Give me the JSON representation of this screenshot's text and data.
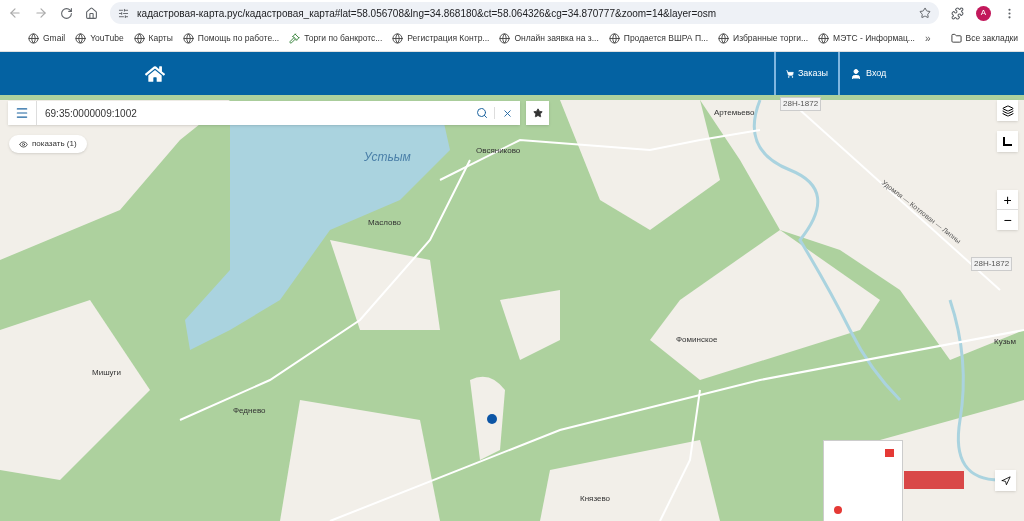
{
  "browser": {
    "url": "кадастровая-карта.рус/кадастровая_карта#lat=58.056708&lng=34.868180&ct=58.064326&cg=34.870777&zoom=14&layer=osm",
    "profile": "A",
    "bookmarks": [
      {
        "label": "Gmail",
        "kind": "globe"
      },
      {
        "label": "YouTube",
        "kind": "globe"
      },
      {
        "label": "Карты",
        "kind": "globe"
      },
      {
        "label": "Помощь по работе...",
        "kind": "globe"
      },
      {
        "label": "Торги по банкротс...",
        "kind": "gavel"
      },
      {
        "label": "Регистрация Контр...",
        "kind": "globe"
      },
      {
        "label": "Онлайн заявка на з...",
        "kind": "globe"
      },
      {
        "label": "Продается ВШРА П...",
        "kind": "globe"
      },
      {
        "label": "Избранные торги...",
        "kind": "globe"
      },
      {
        "label": "МЭТС - Информац...",
        "kind": "globe"
      }
    ],
    "more": "»",
    "all_bookmarks": "Все закладки"
  },
  "header": {
    "nav": [
      {
        "label": "Заказы",
        "kind": "cart"
      },
      {
        "label": "Вход",
        "kind": "user"
      }
    ]
  },
  "search": {
    "value": "69:35:0000009:1002"
  },
  "show_button": "показать (1)",
  "map_labels": [
    {
      "text": "Устьым",
      "kind": "water"
    },
    {
      "text": "Овсяниково",
      "kind": "place"
    },
    {
      "text": "Артемьево",
      "kind": "place"
    },
    {
      "text": "28Н-1872",
      "kind": "road"
    },
    {
      "text": "Маслово",
      "kind": "place"
    },
    {
      "text": "Удомля — Котлован — Липны",
      "kind": "roadname"
    },
    {
      "text": "28Н-1872",
      "kind": "road"
    },
    {
      "text": "Фоминское",
      "kind": "place"
    },
    {
      "text": "Кузьм",
      "kind": "place"
    },
    {
      "text": "Мишуги",
      "kind": "place"
    },
    {
      "text": "Феднево",
      "kind": "place"
    },
    {
      "text": "Князево",
      "kind": "place"
    }
  ],
  "zoom": {
    "in": "+",
    "out": "−"
  }
}
